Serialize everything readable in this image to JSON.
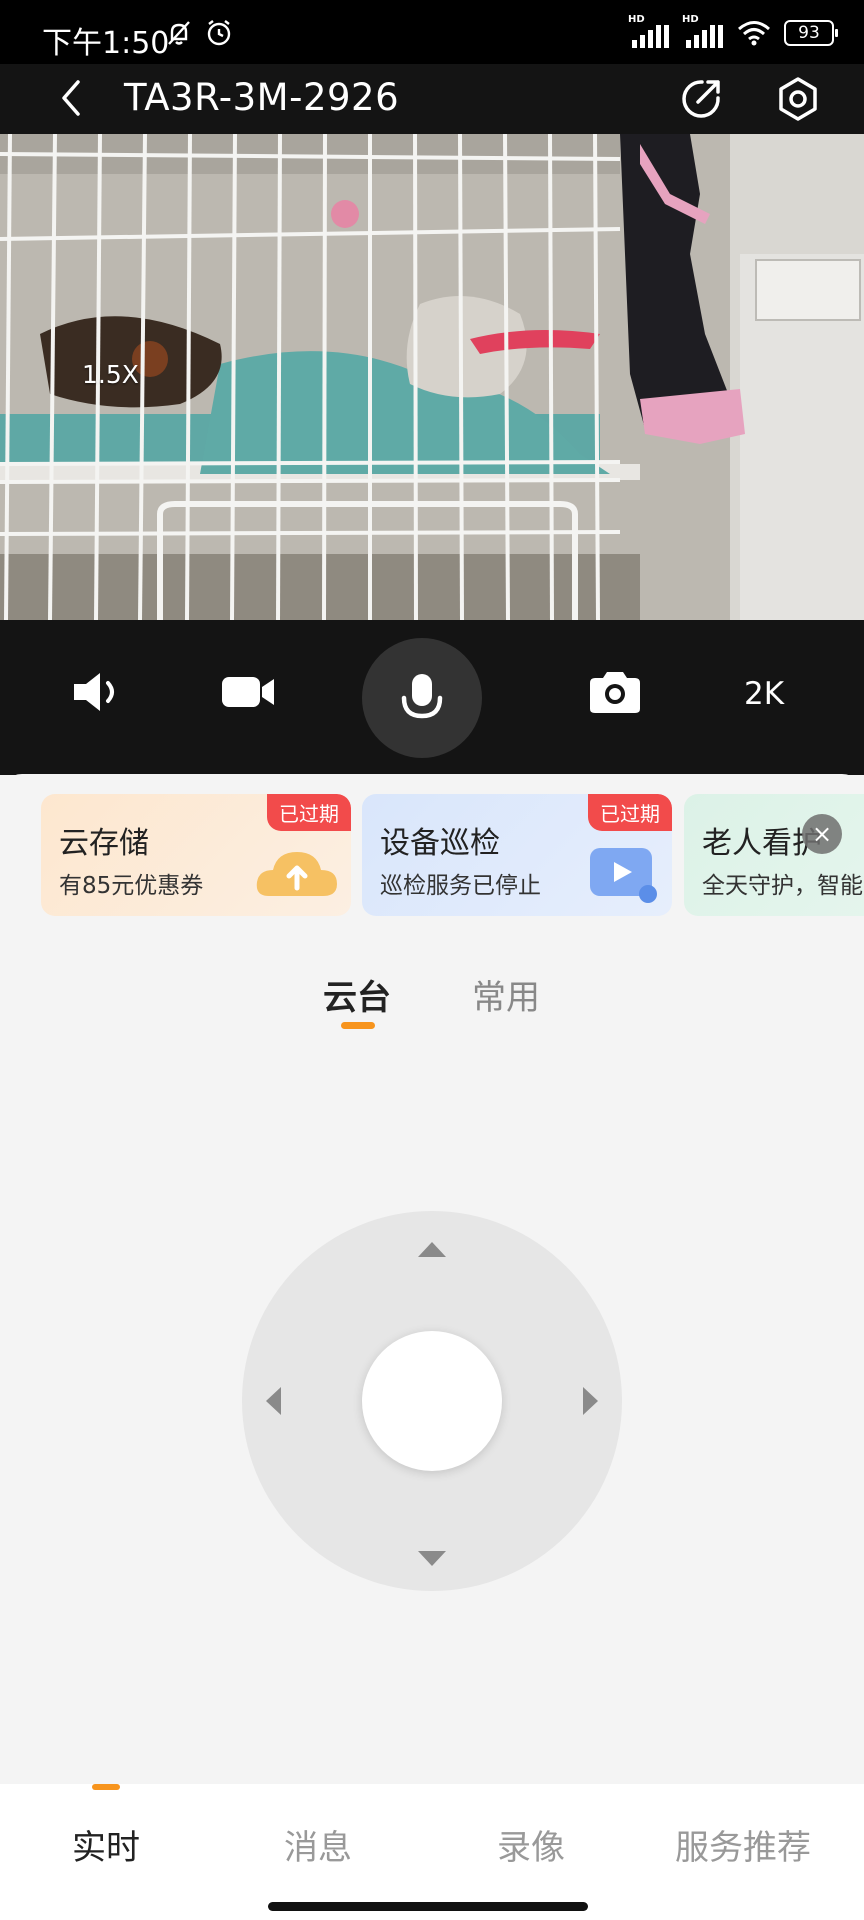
{
  "status_bar": {
    "time": "下午1:50",
    "battery": "93",
    "network_label": "HD",
    "icons": [
      "bell-off-icon",
      "alarm-icon",
      "signal-icon",
      "signal-icon",
      "wifi-icon",
      "battery-icon"
    ]
  },
  "header": {
    "title": "TA3R-3M-2926",
    "icons": [
      "back-chevron-icon",
      "share-icon",
      "settings-hexagon-icon"
    ]
  },
  "video": {
    "zoom": "1.5X"
  },
  "controls": {
    "icons": [
      "speaker-icon",
      "video-record-icon",
      "microphone-icon",
      "camera-icon"
    ],
    "resolution": "2K"
  },
  "cards": [
    {
      "title": "云存储",
      "subtitle": "有85元优惠券",
      "badge": "已过期",
      "color": "#fde9d4",
      "icon": "cloud-upload-icon"
    },
    {
      "title": "设备巡检",
      "subtitle": "巡检服务已停止",
      "badge": "已过期",
      "color": "#dde9fc",
      "icon": "video-chat-icon"
    },
    {
      "title": "老人看护",
      "subtitle": "全天守护，智能",
      "badge": "",
      "color": "#dff3ea",
      "icon": ""
    }
  ],
  "cards_close_label": "×",
  "tabs": {
    "ptz": "云台",
    "common": "常用"
  },
  "bottom_nav": {
    "live": "实时",
    "messages": "消息",
    "recordings": "录像",
    "services": "服务推荐"
  },
  "colors": {
    "accent": "#f7941d",
    "badge": "#f24b4b",
    "dark_bg": "#141414"
  }
}
